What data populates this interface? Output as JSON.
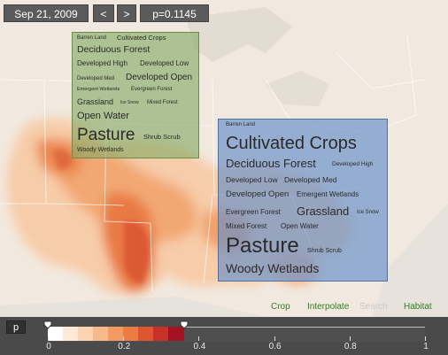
{
  "toolbar": {
    "date": "Sep 21, 2009",
    "prev_label": "<",
    "next_label": ">",
    "p_readout": "p=0.1145"
  },
  "green_panel": {
    "terms": [
      "Barren Land",
      "Cultivated Crops",
      "Deciduous Forest",
      "Developed High",
      "Developed Low",
      "Developed Med",
      "Developed Open",
      "Emergent Wetlands",
      "Evergreen Forest",
      "Grassland",
      "Ice Snow",
      "Mixed Forest",
      "Open Water",
      "Pasture",
      "Shrub Scrub",
      "Woody Wetlands"
    ]
  },
  "blue_panel": {
    "terms": [
      "Barren Land",
      "Cultivated Crops",
      "Deciduous Forest",
      "Developed High",
      "Developed Low",
      "Developed Med",
      "Developed Open",
      "Emergent Wetlands",
      "Evergreen Forest",
      "Grassland",
      "Ice Snow",
      "Mixed Forest",
      "Open Water",
      "Pasture",
      "Shrub Scrub",
      "Woody Wetlands"
    ]
  },
  "links": {
    "crop": "Crop",
    "interpolate": "Interpolate",
    "search": "Search",
    "habitat": "Habitat"
  },
  "legend": {
    "button_label": "p",
    "tick_labels": [
      "0",
      "0.2",
      "0.4",
      "0.6",
      "0.8",
      "1"
    ],
    "ramp_colors": [
      "#ffffff",
      "#fde9d6",
      "#fbd3b1",
      "#f8b98a",
      "#f39a62",
      "#ec7a45",
      "#de5532",
      "#c8302a",
      "#a31220"
    ],
    "range_low": 0,
    "range_high": 0.36
  },
  "colors": {
    "link_active": "#2f7f1f",
    "link_disabled": "#c8c8c8",
    "green_panel": "#82aa64",
    "blue_panel": "#6991c8"
  }
}
